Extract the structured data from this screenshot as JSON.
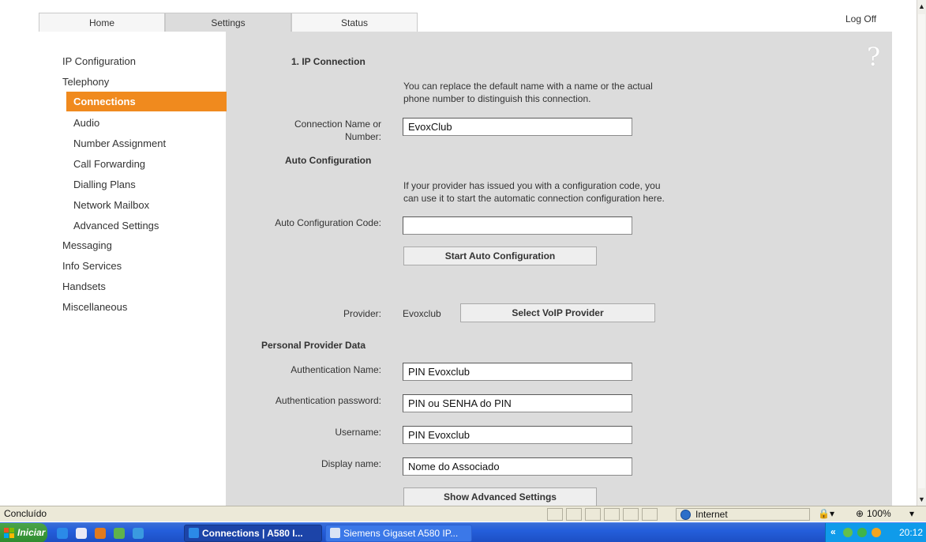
{
  "tabs": {
    "home": "Home",
    "settings": "Settings",
    "status": "Status"
  },
  "header": {
    "logoff": "Log Off",
    "help": "?"
  },
  "sidebar": {
    "items": [
      {
        "label": "IP Configuration"
      },
      {
        "label": "Telephony"
      },
      {
        "label": "Messaging"
      },
      {
        "label": "Info Services"
      },
      {
        "label": "Handsets"
      },
      {
        "label": "Miscellaneous"
      }
    ],
    "telephony_sub": [
      {
        "label": "Connections"
      },
      {
        "label": "Audio"
      },
      {
        "label": "Number Assignment"
      },
      {
        "label": "Call Forwarding"
      },
      {
        "label": "Dialling Plans"
      },
      {
        "label": "Network Mailbox"
      },
      {
        "label": "Advanced Settings"
      }
    ]
  },
  "form": {
    "section_ip": "1. IP Connection",
    "hint_name_1": "You can replace the default name with a name or the actual",
    "hint_name_2": "phone number to distinguish this connection.",
    "label_conn_name_1": "Connection Name or",
    "label_conn_name_2": "Number:",
    "conn_name_value": "EvoxClub",
    "section_auto": "Auto Configuration",
    "hint_auto_1": "If your provider has issued you with a configuration code, you",
    "hint_auto_2": "can use it to start the automatic connection configuration here.",
    "label_auto_code": "Auto Configuration Code:",
    "auto_code_value": "",
    "btn_start_auto": "Start Auto Configuration",
    "label_provider": "Provider:",
    "provider_value": "Evoxclub",
    "btn_select_provider": "Select VoIP Provider",
    "section_personal": "Personal Provider Data",
    "label_auth_name": "Authentication Name:",
    "auth_name_value": "PIN Evoxclub",
    "label_auth_pw": "Authentication password:",
    "auth_pw_value": "PIN ou SENHA do PIN",
    "label_username": "Username:",
    "username_value": "PIN Evoxclub",
    "label_display": "Display name:",
    "display_value": "Nome do Associado",
    "btn_show_adv": "Show Advanced Settings"
  },
  "statusbar": {
    "text": "Concluído",
    "zone": "Internet",
    "zoom": "100%"
  },
  "taskbar": {
    "start": "Iniciar",
    "task_active": "Connections | A580 I...",
    "task_inactive": "Siemens Gigaset A580 IP...",
    "clock": "20:12"
  },
  "colors": {
    "accent": "#f08a1e",
    "content_bg": "#dcdcdc"
  }
}
